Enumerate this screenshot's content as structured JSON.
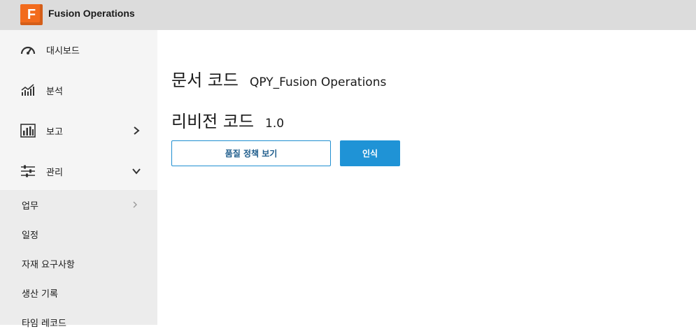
{
  "app": {
    "logo_letter": "F",
    "title": "Fusion Operations",
    "brand_color": "#f26b1d"
  },
  "sidebar": {
    "items": [
      {
        "label": "대시보드",
        "icon": "dashboard-gauge-icon"
      },
      {
        "label": "분석",
        "icon": "analytics-chart-icon"
      },
      {
        "label": "보고",
        "icon": "report-bars-icon",
        "chevron": "chevron-right-icon"
      },
      {
        "label": "관리",
        "icon": "sliders-icon",
        "chevron": "chevron-down-icon"
      }
    ],
    "sub_items": [
      {
        "label": "업무",
        "chevron": "chevron-right-icon"
      },
      {
        "label": "일정"
      },
      {
        "label": "자재 요구사항"
      },
      {
        "label": "생산 기록"
      },
      {
        "label": "타임 레코드"
      }
    ]
  },
  "main": {
    "doc_code_label": "문서 코드",
    "doc_code_value": "QPY_Fusion Operations",
    "revision_label": "리비전 코드",
    "revision_value": "1.0",
    "view_policy_button": "품질 정책 보기",
    "acknowledge_button": "인식",
    "accent_color": "#1f93d6"
  }
}
